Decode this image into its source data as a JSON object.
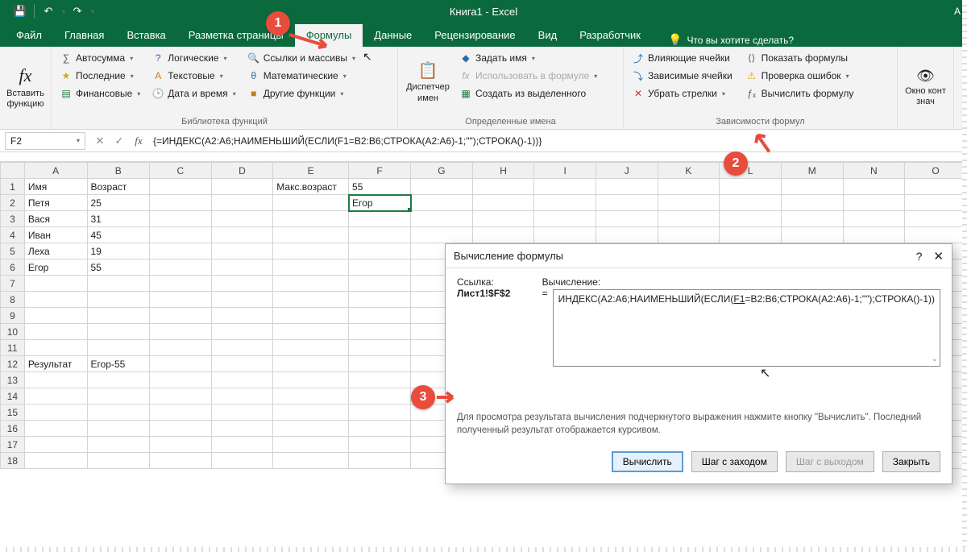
{
  "title": "Книга1  -  Excel",
  "title_right": "А",
  "qat": {
    "save": "💾",
    "undo": "↶",
    "redo": "↷"
  },
  "tabs": [
    "Файл",
    "Главная",
    "Вставка",
    "Разметка страницы",
    "Формулы",
    "Данные",
    "Рецензирование",
    "Вид",
    "Разработчик"
  ],
  "active_tab": "Формулы",
  "tellme": "Что вы хотите сделать?",
  "ribbon": {
    "insert_fn": "Вставить функцию",
    "lib": {
      "autosum": "Автосумма",
      "recent": "Последние",
      "financial": "Финансовые",
      "logical": "Логические",
      "text": "Текстовые",
      "datetime": "Дата и время",
      "lookup": "Ссылки и массивы",
      "math": "Математические",
      "more": "Другие функции",
      "label": "Библиотека функций"
    },
    "names": {
      "mgr": "Диспетчер имен",
      "define": "Задать имя",
      "use": "Использовать в формуле",
      "create": "Создать из выделенного",
      "label": "Определенные имена"
    },
    "audit": {
      "precedents": "Влияющие ячейки",
      "dependents": "Зависимые ячейки",
      "remove": "Убрать стрелки",
      "show": "Показать формулы",
      "check": "Проверка ошибок",
      "eval": "Вычислить формулу",
      "label": "Зависимости формул"
    },
    "watch": "Окно конт",
    "watch2": "знач"
  },
  "namebox": "F2",
  "formula": "{=ИНДЕКС(A2:A6;НАИМЕНЬШИЙ(ЕСЛИ(F1=B2:B6;СТРОКА(A2:A6)-1;\"\");СТРОКА()-1))}",
  "cols": [
    "A",
    "B",
    "C",
    "D",
    "E",
    "F",
    "G",
    "H",
    "I",
    "J",
    "K",
    "L",
    "M",
    "N",
    "O"
  ],
  "sheet": {
    "r1": {
      "A": "Имя",
      "B": "Возраст",
      "E": "Макс.возраст",
      "F": "55"
    },
    "r2": {
      "A": "Петя",
      "B": "25",
      "F": "Егор"
    },
    "r3": {
      "A": "Вася",
      "B": "31"
    },
    "r4": {
      "A": "Иван",
      "B": "45"
    },
    "r5": {
      "A": "Леха",
      "B": "19"
    },
    "r6": {
      "A": "Егор",
      "B": "55"
    },
    "r12": {
      "A": "Результат",
      "B": "Егор-55"
    }
  },
  "dialog": {
    "title": "Вычисление формулы",
    "ref_label": "Ссылка:",
    "ref": "Лист1!$F$2",
    "eval_label": "Вычисление:",
    "eval_pre": "ИНДЕКС(A2:A6;НАИМЕНЬШИЙ(ЕСЛИ(",
    "eval_u": "F1",
    "eval_post": "=B2:B6;СТРОКА(A2:A6)-1;\"\");СТРОКА()-1))",
    "hint": "Для просмотра результата вычисления подчеркнутого выражения нажмите кнопку \"Вычислить\". Последний полученный результат отображается курсивом.",
    "btn_eval": "Вычислить",
    "btn_stepin": "Шаг с заходом",
    "btn_stepout": "Шаг с выходом",
    "btn_close": "Закрыть"
  },
  "callouts": {
    "c1": "1",
    "c2": "2",
    "c3": "3"
  }
}
